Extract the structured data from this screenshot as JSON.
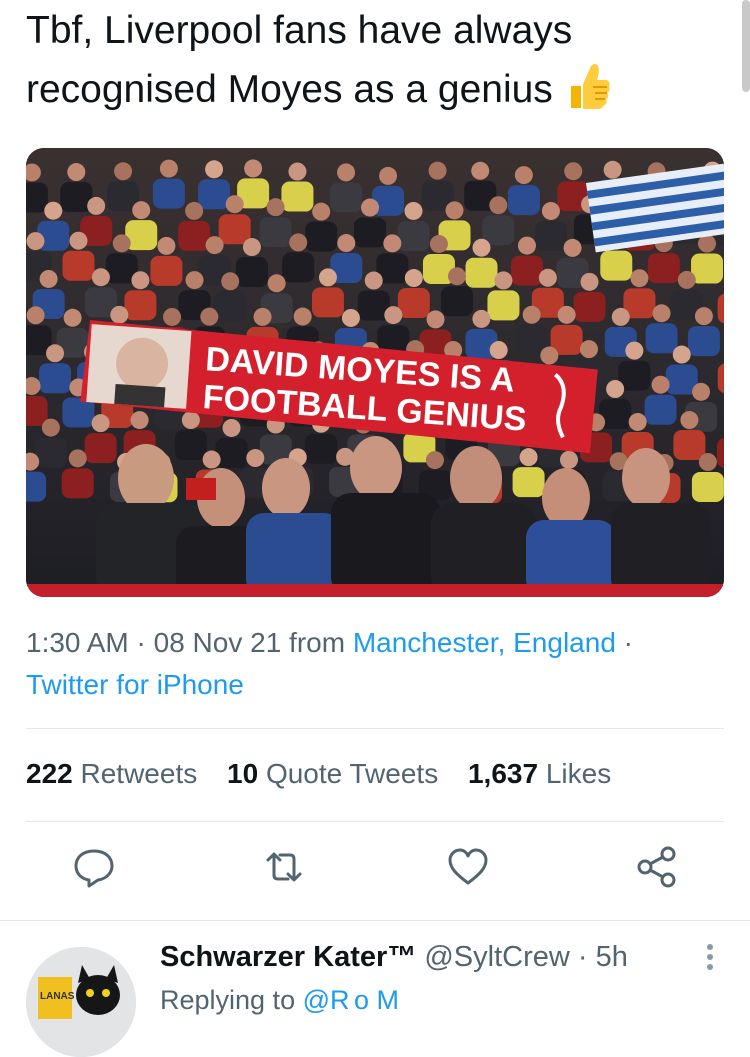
{
  "tweet": {
    "text": "Tbf, Liverpool fans have always recognised Moyes as a genius",
    "emoji_icon": "thumbs-up-emoji",
    "image": {
      "banner_line1": "DAVID MOYES IS A",
      "banner_line2": "FOOTBALL GENIUS"
    },
    "time": "1:30 AM",
    "date": "08 Nov 21",
    "from_label": "from",
    "location": "Manchester, England",
    "source": "Twitter for iPhone"
  },
  "stats": {
    "retweets_count": "222",
    "retweets_label": "Retweets",
    "quotes_count": "10",
    "quotes_label": "Quote Tweets",
    "likes_count": "1,637",
    "likes_label": "Likes"
  },
  "actions": [
    {
      "icon": "reply-icon"
    },
    {
      "icon": "retweet-icon"
    },
    {
      "icon": "like-icon"
    },
    {
      "icon": "share-icon"
    }
  ],
  "reply": {
    "name": "Schwarzer Kater™",
    "handle": "@SyltCrew",
    "separator": "·",
    "age": "5h",
    "replying_prefix": "Replying to",
    "replying_to": "@R o M",
    "avatar_text": "LANAS"
  },
  "colors": {
    "accent": "#1d9bf0",
    "secondary_text": "#536471",
    "banner_red": "#d41f2c"
  }
}
